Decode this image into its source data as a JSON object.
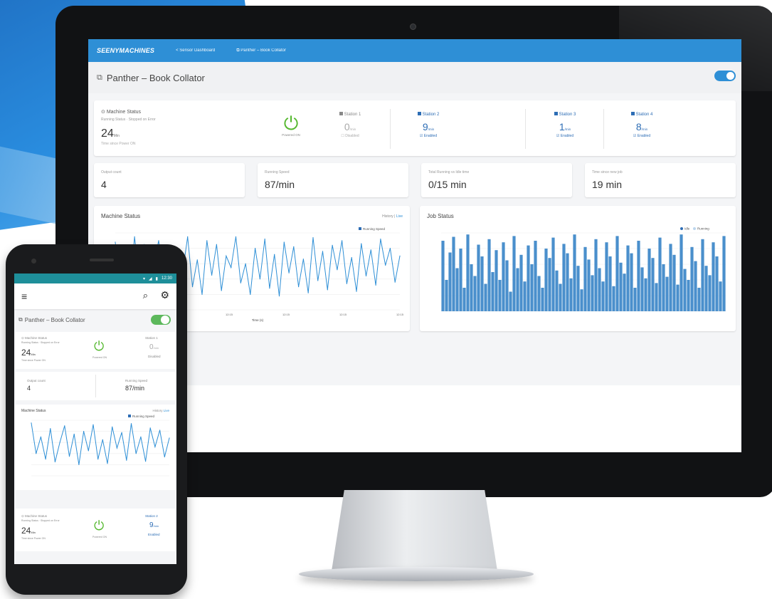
{
  "colors": {
    "brand_blue": "#2e8fd6",
    "station_blue": "#2d6db5",
    "power_green": "#55b82f",
    "phone_status_teal": "#1e8f9a",
    "phone_toggle_green": "#5cb85c"
  },
  "desktop": {
    "nav": {
      "logo": "SEENYMACHINES",
      "link_sensor": "Sensor Dashboard",
      "link_panther": "Panther – Book Collator"
    },
    "page_title": "Panther – Book Collator",
    "machine_status": {
      "title": "Machine Status",
      "subtitle": "Running Status · Stopped on Error",
      "value": "24",
      "unit": "Min",
      "footer": "Time since Power ON",
      "power_label": "Powered ON"
    },
    "stations": [
      {
        "label": "Station 1",
        "value": "0",
        "unit": "/min",
        "status": "Disabled",
        "enabled": false
      },
      {
        "label": "Station 2",
        "value": "9",
        "unit": "/min",
        "status": "Enabled",
        "enabled": true
      },
      {
        "label": "Station 3",
        "value": "1",
        "unit": "/min",
        "status": "Enabled",
        "enabled": true
      },
      {
        "label": "Station 4",
        "value": "8",
        "unit": "/min",
        "status": "Enabled",
        "enabled": true
      }
    ],
    "metrics": [
      {
        "label": "Output count",
        "value": "4"
      },
      {
        "label": "Running Speed",
        "value": "87/min"
      },
      {
        "label": "Total Running vs Idle time",
        "value": "0/15 min"
      },
      {
        "label": "Time since new job",
        "value": "19 min"
      }
    ],
    "charts": {
      "machine": {
        "title": "Machine Status",
        "tool_history": "History",
        "tool_live": "Live"
      },
      "job": {
        "title": "Job Status"
      }
    }
  },
  "phone": {
    "status_time": "12:30",
    "icons": {
      "menu": "menu-icon",
      "search": "search-icon",
      "settings": "gear-icon"
    },
    "page_title": "Panther – Book Collator",
    "machine_status": {
      "title": "Machine Status",
      "subtitle": "Running Status · Stopped on Error",
      "value": "24",
      "unit": "Min",
      "footer": "Time since Power ON",
      "power_label": "Powered ON"
    },
    "station": {
      "label": "Station 1",
      "value": "0",
      "unit": "/min",
      "status": "Disabled"
    },
    "station2": {
      "label": "Station 2",
      "value": "9",
      "unit": "/min",
      "status": "Enabled"
    },
    "metrics": [
      {
        "label": "Output count",
        "value": "4"
      },
      {
        "label": "Running Speed",
        "value": "87/min"
      }
    ],
    "chart": {
      "title": "Machine Status",
      "tool_history": "History",
      "tool_live": "Live"
    }
  },
  "chart_data": [
    {
      "type": "line",
      "title": "Machine Status",
      "series": [
        {
          "name": "Running Speed",
          "values": [
            88,
            30,
            70,
            20,
            95,
            40,
            85,
            25,
            60,
            90,
            35,
            75,
            15,
            80,
            50,
            95,
            30,
            65,
            20,
            90,
            45,
            85,
            25,
            70,
            55,
            95,
            35,
            60,
            20,
            80,
            40,
            92,
            28,
            72,
            18,
            88,
            48,
            82,
            30,
            66,
            22,
            94,
            38,
            76,
            26,
            84,
            52,
            90,
            34,
            68,
            24,
            86,
            44,
            78,
            32,
            92,
            58,
            80,
            36,
            70
          ]
        }
      ],
      "x_ticks": [
        "12:15",
        "12:15",
        "12:15",
        "12:15",
        "12:15",
        "12:15"
      ],
      "xlabel": "Time (s)",
      "ylim": [
        0,
        100
      ],
      "grid": true,
      "legend": "top-right"
    },
    {
      "type": "bar",
      "title": "Job Status",
      "series": [
        {
          "name": "Idle",
          "values": []
        },
        {
          "name": "Running",
          "values": [
            90,
            40,
            75,
            95,
            55,
            80,
            30,
            98,
            60,
            45,
            85,
            70,
            35,
            92,
            50,
            78,
            40,
            88,
            65,
            25,
            96,
            55,
            72,
            38,
            84,
            60,
            90,
            45,
            30,
            80,
            68,
            94,
            52,
            35,
            86,
            74,
            42,
            98,
            58,
            28,
            82,
            66,
            46,
            92,
            55,
            38,
            88,
            70,
            32,
            96,
            62,
            48,
            84,
            74,
            30,
            90,
            56,
            42,
            80,
            68,
            36,
            94,
            60,
            44,
            86,
            72,
            34,
            98,
            54,
            40,
            82,
            64,
            30,
            92,
            58,
            46,
            88,
            70,
            38,
            96
          ]
        }
      ],
      "ylim": [
        0,
        100
      ],
      "grid": true,
      "legend": "top-right"
    },
    {
      "type": "line",
      "title": "Machine Status",
      "series": [
        {
          "name": "Running Speed",
          "values": [
            95,
            40,
            70,
            30,
            85,
            25,
            60,
            90,
            35,
            75,
            20,
            80,
            45,
            92,
            30,
            65,
            22,
            88,
            50,
            78,
            28,
            94,
            40,
            70,
            26,
            86,
            52,
            82,
            34,
            68
          ]
        }
      ],
      "ylim": [
        0,
        100
      ],
      "grid": true,
      "legend": "top-right"
    }
  ]
}
